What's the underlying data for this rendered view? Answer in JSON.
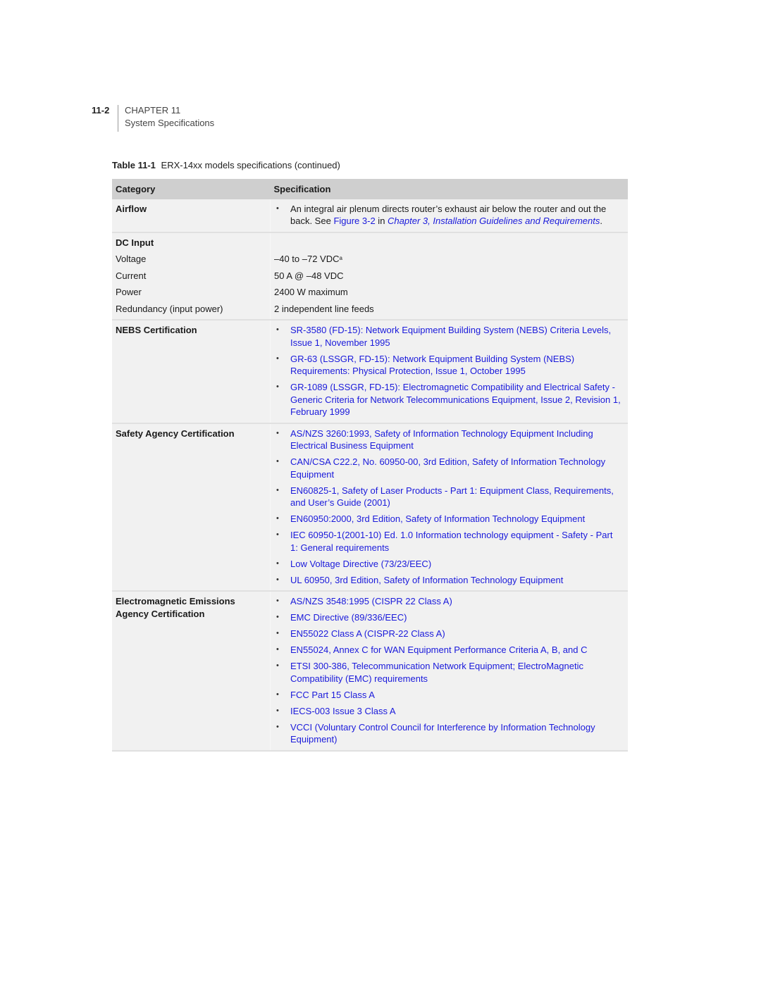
{
  "header": {
    "page_number": "11-2",
    "chapter": "CHAPTER 11",
    "section": "System Specifications"
  },
  "caption": {
    "label": "Table 11-1",
    "title": "ERX-14xx models specifications (continued)"
  },
  "table": {
    "columns": [
      "Category",
      "Specification"
    ],
    "airflow": {
      "category": "Airflow",
      "text_before": "An integral air plenum directs router’s exhaust air below the router and out the back. See ",
      "figure_link": "Figure 3-2",
      "text_mid": " in ",
      "chapter_link": "Chapter 3, Installation Guidelines and Requirements",
      "text_after": "."
    },
    "dc_input": {
      "category": "DC Input",
      "rows": [
        {
          "label": "Voltage",
          "value": "–40 to –72 VDC",
          "footnote": "a"
        },
        {
          "label": "Current",
          "value": "50 A @ –48 VDC",
          "footnote": ""
        },
        {
          "label": "Power",
          "value": "2400 W maximum",
          "footnote": ""
        },
        {
          "label": "Redundancy (input power)",
          "value": "2 independent line feeds",
          "footnote": ""
        }
      ]
    },
    "nebs": {
      "category": "NEBS Certification",
      "items": [
        "SR-3580 (FD-15): Network Equipment Building System (NEBS) Criteria Levels, Issue 1, November 1995",
        "GR-63 (LSSGR, FD-15): Network Equipment Building System (NEBS) Requirements: Physical Protection, Issue 1, October 1995",
        "GR-1089 (LSSGR, FD-15): Electromagnetic Compatibility and Electrical Safety - Generic Criteria for Network Telecommunications Equipment, Issue 2, Revision 1, February 1999"
      ]
    },
    "safety": {
      "category": "Safety Agency Certification",
      "items": [
        "AS/NZS 3260:1993, Safety of Information Technology Equipment Including Electrical Business Equipment",
        "CAN/CSA C22.2, No. 60950-00, 3rd Edition, Safety of Information Technology Equipment",
        "EN60825-1, Safety of Laser Products - Part 1: Equipment Class, Requirements, and User’s Guide (2001)",
        "EN60950:2000, 3rd Edition, Safety of Information Technology Equipment",
        "IEC 60950-1(2001-10) Ed. 1.0 Information technology equipment - Safety - Part 1: General requirements",
        "Low Voltage Directive (73/23/EEC)",
        "UL 60950, 3rd Edition, Safety of Information Technology Equipment"
      ]
    },
    "emissions": {
      "category": "Electromagnetic Emissions Agency Certification",
      "items": [
        "AS/NZS 3548:1995 (CISPR 22 Class A)",
        "EMC Directive (89/336/EEC)",
        "EN55022 Class A (CISPR-22 Class A)",
        "EN55024, Annex C for WAN Equipment Performance Criteria A, B, and C",
        "ETSI 300-386, Telecommunication Network Equipment; ElectroMagnetic Compatibility (EMC) requirements",
        "FCC Part 15 Class A",
        "IECS-003 Issue 3 Class A",
        "VCCI (Voluntary Control Council for Interference by Information Technology Equipment)"
      ]
    }
  },
  "colors": {
    "link": "#1a1adb",
    "header_row": "#cfcfcf",
    "cell_bg": "#f1f1f1"
  }
}
